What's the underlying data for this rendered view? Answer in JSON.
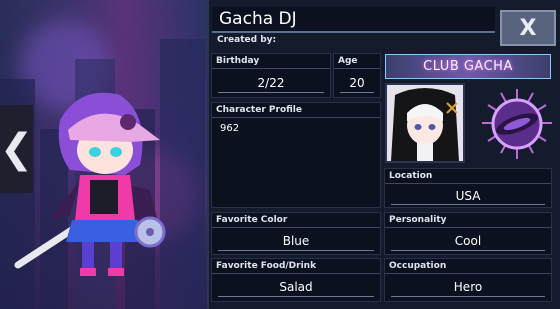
{
  "header": {
    "character_name": "Gacha DJ",
    "created_by_label": "Created by:",
    "close_label": "X"
  },
  "fields": {
    "birthday": {
      "label": "Birthday",
      "value": "2/22"
    },
    "age": {
      "label": "Age",
      "value": "20"
    },
    "profile": {
      "label": "Character Profile",
      "value": "962"
    },
    "location": {
      "label": "Location",
      "value": "USA"
    },
    "favorite_color": {
      "label": "Favorite Color",
      "value": "Blue"
    },
    "personality": {
      "label": "Personality",
      "value": "Cool"
    },
    "favorite_food": {
      "label": "Favorite Food/Drink",
      "value": "Salad"
    },
    "occupation": {
      "label": "Occupation",
      "value": "Hero"
    }
  },
  "club": {
    "banner_label": "CLUB GACHA"
  },
  "navigation": {
    "prev_arrow": "❮"
  },
  "icons": [
    "chevron-left-icon",
    "close-icon"
  ],
  "colors": {
    "panel_bg": "#141b2d",
    "box_bg": "#0c1120",
    "close_button": "#58647e",
    "club_border": "#8ac7ff"
  }
}
